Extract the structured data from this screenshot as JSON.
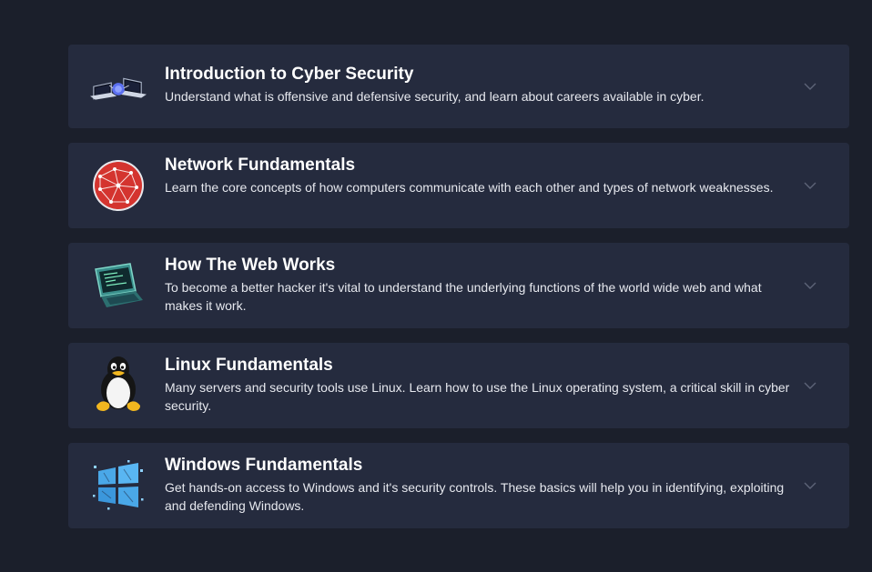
{
  "modules": [
    {
      "title": "Introduction to Cyber Security",
      "description": "Understand what is offensive and defensive security, and learn about careers available in cyber.",
      "icon": "laptops-network-icon"
    },
    {
      "title": "Network Fundamentals",
      "description": "Learn the core concepts of how computers communicate with each other and types of network weaknesses.",
      "icon": "network-globe-icon"
    },
    {
      "title": "How The Web Works",
      "description": "To become a better hacker it's vital to understand the underlying functions of the world wide web and what makes it work.",
      "icon": "laptop-code-icon"
    },
    {
      "title": "Linux Fundamentals",
      "description": "Many servers and security tools use Linux. Learn how to use the Linux operating system, a critical skill in cyber security.",
      "icon": "linux-penguin-icon"
    },
    {
      "title": "Windows Fundamentals",
      "description": "Get hands-on access to Windows and it's security controls. These basics will help you in identifying, exploiting and defending Windows.",
      "icon": "windows-logo-icon"
    }
  ],
  "colors": {
    "background": "#1b1f2b",
    "card": "#252b3e",
    "title": "#ffffff",
    "description": "#e6e8ee",
    "chevron": "#5d6478"
  }
}
